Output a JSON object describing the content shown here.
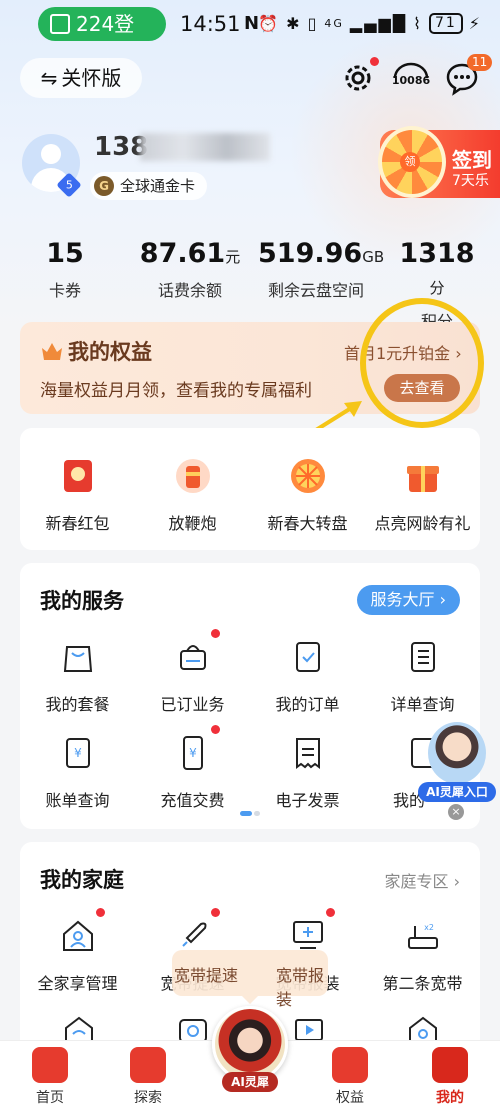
{
  "status_bar": {
    "pill_text": "224登",
    "time": "14:51",
    "nfc": "N",
    "signal": "4G",
    "battery": "71"
  },
  "header": {
    "care_mode_label": "关怀版",
    "service_number": "10086",
    "message_badge": "11"
  },
  "user": {
    "phone_prefix": "138",
    "level": "5",
    "card_name": "全球通金卡"
  },
  "signin": {
    "title": "签到",
    "subtitle": "7天乐",
    "wheel_text": "领"
  },
  "stats": [
    {
      "value": "15",
      "unit": "",
      "label": "卡券"
    },
    {
      "value": "87.61",
      "unit": "元",
      "label": "话费余额"
    },
    {
      "value": "519.96",
      "unit": "GB",
      "label": "剩余云盘空间"
    },
    {
      "value": "1318",
      "unit": "分",
      "label": "积分"
    }
  ],
  "rights": {
    "title": "我的权益",
    "promo": "首月1元升铂金",
    "promo_arrow": "›",
    "desc": "海量权益月月领，查看我的专属福利",
    "button": "去查看"
  },
  "promos": [
    {
      "label": "新春红包",
      "icon": "red-envelope-icon"
    },
    {
      "label": "放鞭炮",
      "icon": "firecracker-icon"
    },
    {
      "label": "新春大转盘",
      "icon": "prize-wheel-icon"
    },
    {
      "label": "点亮网龄有礼",
      "icon": "gift-box-icon"
    }
  ],
  "services": {
    "title": "我的服务",
    "hall_button": "服务大厅 ›",
    "items": [
      {
        "label": "我的套餐",
        "icon": "shopping-bag-icon",
        "dot": false
      },
      {
        "label": "已订业务",
        "icon": "basket-icon",
        "dot": true
      },
      {
        "label": "我的订单",
        "icon": "clipboard-icon",
        "dot": false
      },
      {
        "label": "详单查询",
        "icon": "list-icon",
        "dot": false
      },
      {
        "label": "账单查询",
        "icon": "bill-icon",
        "dot": false
      },
      {
        "label": "充值交费",
        "icon": "phone-yuan-icon",
        "dot": true
      },
      {
        "label": "电子发票",
        "icon": "invoice-icon",
        "dot": false
      },
      {
        "label": "我的",
        "icon": "document-icon",
        "dot": false
      }
    ]
  },
  "ai_entry": {
    "label": "AI灵犀入口",
    "close": "×"
  },
  "family": {
    "title": "我的家庭",
    "zone_link": "家庭专区 ›",
    "items": [
      {
        "label": "全家享管理",
        "icon": "home-person-icon",
        "dot": true
      },
      {
        "label": "宽带提速",
        "icon": "rocket-icon",
        "dot": true
      },
      {
        "label": "宽带报装",
        "icon": "monitor-plus-icon",
        "dot": true
      },
      {
        "label": "第二条宽带",
        "icon": "router-icon",
        "dot": false
      }
    ],
    "tooltip": [
      "宽带提速",
      "宽带报装"
    ]
  },
  "bottom_nav": [
    {
      "label": "首页",
      "icon": "home-icon"
    },
    {
      "label": "探索",
      "icon": "explore-icon"
    },
    {
      "label": "权益",
      "icon": "rights-icon"
    },
    {
      "label": "我的",
      "icon": "profile-icon"
    }
  ],
  "ai_center": {
    "label": "AI灵犀"
  },
  "colors": {
    "accent_blue": "#4c9bf0",
    "brand_red": "#e63b2e",
    "annotation_yellow": "#f5c517",
    "status_green": "#24b35a"
  }
}
